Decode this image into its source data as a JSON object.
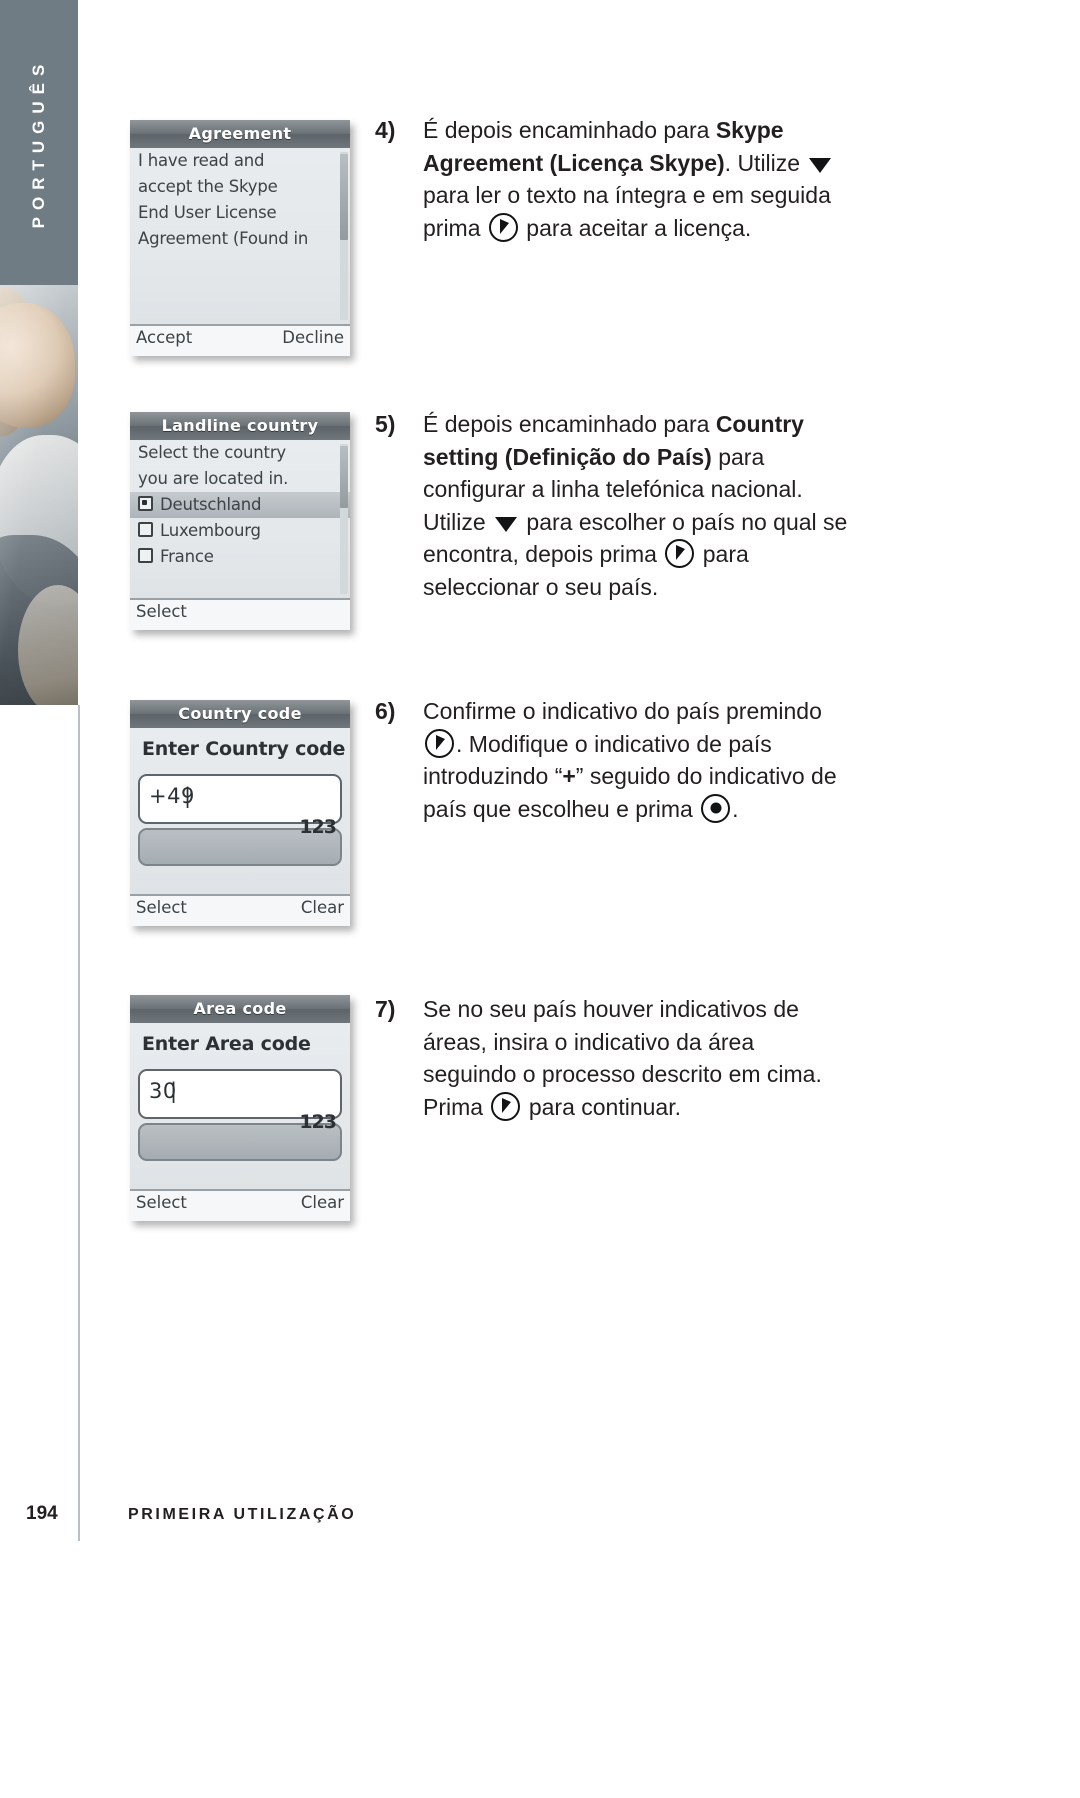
{
  "sidebar": {
    "language_tab": "PORTUGUÊS",
    "photo_alt": "woman-photo"
  },
  "screens": [
    {
      "id": "agreement",
      "title": "Agreement",
      "lines": [
        "I have read and",
        "accept the Skype",
        "End User License",
        "Agreement (Found in"
      ],
      "softkey_left": "Accept",
      "softkey_right": "Decline"
    },
    {
      "id": "landline-country",
      "title": "Landline country",
      "lines": [
        "Select the country",
        "you are located in."
      ],
      "options": [
        {
          "label": "Deutschland",
          "selected": true
        },
        {
          "label": "Luxembourg",
          "selected": false
        },
        {
          "label": "France",
          "selected": false
        }
      ],
      "softkey_left": "Select",
      "softkey_right": ""
    },
    {
      "id": "country-code",
      "title": "Country code",
      "prompt": "Enter Country code",
      "input_value": "+49",
      "ime_indicator": "123",
      "softkey_left": "Select",
      "softkey_right": "Clear"
    },
    {
      "id": "area-code",
      "title": "Area code",
      "prompt": "Enter Area code",
      "input_value": "30",
      "ime_indicator": "123",
      "softkey_left": "Select",
      "softkey_right": "Clear"
    }
  ],
  "steps": [
    {
      "number": "4)",
      "parts": [
        {
          "t": "text",
          "v": "É depois encaminhado para "
        },
        {
          "t": "bold",
          "v": "Skype Agreement (Licença Skype)"
        },
        {
          "t": "text",
          "v": ". Utilize "
        },
        {
          "t": "icon",
          "v": "down-arrow-icon"
        },
        {
          "t": "text",
          "v": " para ler o texto na íntegra e em seguida prima "
        },
        {
          "t": "icon",
          "v": "ok-key-icon"
        },
        {
          "t": "text",
          "v": " para aceitar a licença."
        }
      ]
    },
    {
      "number": "5)",
      "parts": [
        {
          "t": "text",
          "v": "É depois encaminhado para "
        },
        {
          "t": "bold",
          "v": "Country setting (Definição do País)"
        },
        {
          "t": "text",
          "v": " para configurar a linha telefónica nacional. Utilize "
        },
        {
          "t": "icon",
          "v": "down-arrow-icon"
        },
        {
          "t": "text",
          "v": " para escolher o país no qual se encontra, depois prima "
        },
        {
          "t": "icon",
          "v": "ok-key-icon"
        },
        {
          "t": "text",
          "v": " para seleccionar o seu país."
        }
      ]
    },
    {
      "number": "6)",
      "parts": [
        {
          "t": "text",
          "v": "Confirme o indicativo do país premindo "
        },
        {
          "t": "icon",
          "v": "ok-key-icon"
        },
        {
          "t": "text",
          "v": ". Modifique o indicativo de país introduzindo “"
        },
        {
          "t": "bold",
          "v": "+"
        },
        {
          "t": "text",
          "v": "” seguido do indicativo de país que escolheu e prima "
        },
        {
          "t": "icon",
          "v": "center-dot-key-icon"
        },
        {
          "t": "text",
          "v": "."
        }
      ]
    },
    {
      "number": "7)",
      "parts": [
        {
          "t": "text",
          "v": "Se no seu país houver indicativos de áreas, insira o indicativo da área seguindo o processo descrito em cima. Prima "
        },
        {
          "t": "icon",
          "v": "ok-key-icon"
        },
        {
          "t": "text",
          "v": " para continuar."
        }
      ]
    }
  ],
  "footer": {
    "page_number": "194",
    "section_title": "PRIMEIRA UTILIZAÇÃO"
  },
  "colors": {
    "tab_bg": "#6f7c84",
    "text": "#231f20",
    "lcd_title_bg": "#6c7378",
    "rule": "#b7c0c4"
  }
}
